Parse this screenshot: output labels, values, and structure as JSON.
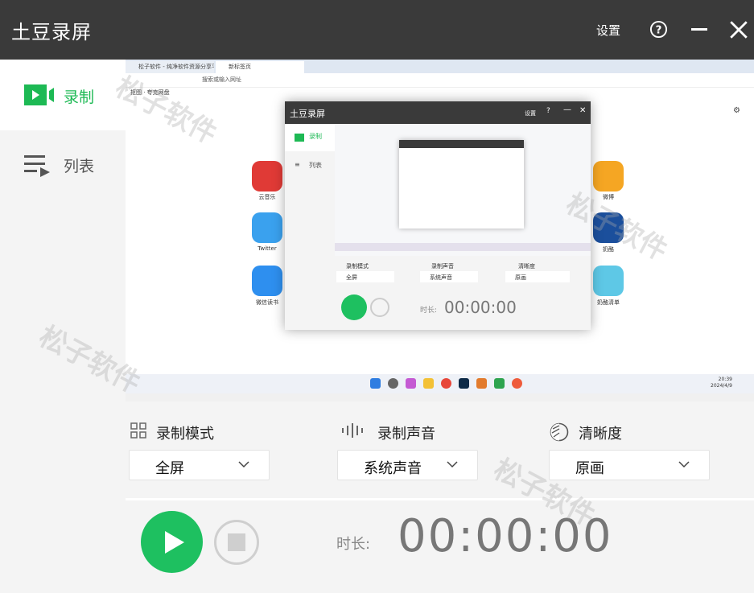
{
  "window": {
    "title": "土豆录屏",
    "settings_label": "设置"
  },
  "sidebar": {
    "items": [
      {
        "label": "录制",
        "active": true
      },
      {
        "label": "列表",
        "active": false
      }
    ]
  },
  "preview": {
    "browser_tabs": [
      "松子软件 - 纯净软件资源分享平台",
      "新标签页"
    ],
    "url_placeholder": "搜索或输入网址",
    "bookmark": "抠图 · 夸克网盘",
    "desktop_apps": [
      {
        "label": "云音乐",
        "color": "#e03a36"
      },
      {
        "label": "Twitter",
        "color": "#3aa1ee"
      },
      {
        "label": "微信读书",
        "color": "#2e8fef"
      },
      {
        "label": "微博",
        "color": "#f5a623"
      },
      {
        "label": "奶酪",
        "color": "#1b4f9c"
      },
      {
        "label": "奶酪清单",
        "color": "#5ec8e6"
      }
    ],
    "inner_window": {
      "title": "土豆录屏",
      "settings_label": "设置",
      "nav": [
        "录制",
        "列表"
      ],
      "mode_label": "录制模式",
      "mode_value": "全屏",
      "audio_label": "录制声音",
      "audio_value": "系统声音",
      "quality_label": "清晰度",
      "quality_value": "原画",
      "duration_label": "时长:",
      "timer": "00:00:00"
    },
    "taskbar_time": "20:39",
    "taskbar_date": "2024/4/9"
  },
  "settings": {
    "mode": {
      "label": "录制模式",
      "value": "全屏"
    },
    "audio": {
      "label": "录制声音",
      "value": "系统声音"
    },
    "quality": {
      "label": "清晰度",
      "value": "原画"
    }
  },
  "controls": {
    "duration_label": "时长:",
    "timer": "00:00:00"
  },
  "watermark": "松子软件",
  "colors": {
    "accent": "#1ec060",
    "titlebar": "#3a3a3a"
  }
}
